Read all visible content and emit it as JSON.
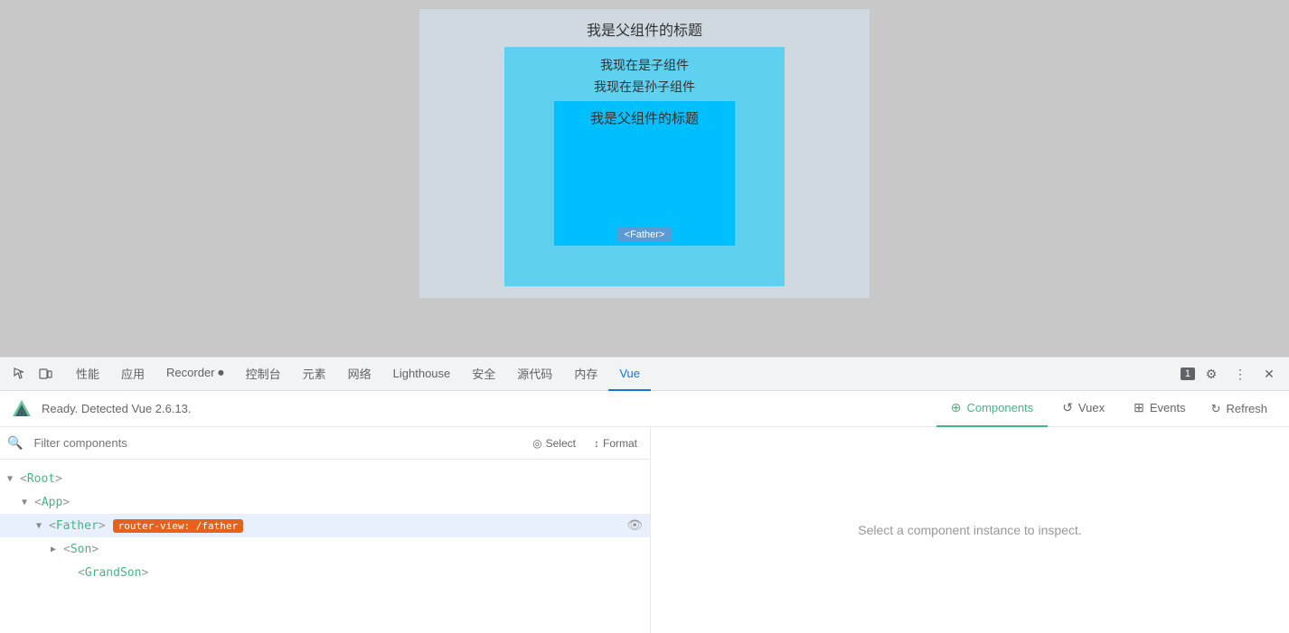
{
  "preview": {
    "outer_title": "我是父组件的标题",
    "child_text": "我现在是子组件",
    "grandchild_text": "我现在是孙子组件",
    "inner_title": "我是父组件的标题",
    "father_badge": "<Father>"
  },
  "devtools": {
    "tabs": [
      {
        "label": "性能",
        "active": false
      },
      {
        "label": "应用",
        "active": false
      },
      {
        "label": "Recorder ⏺",
        "active": false
      },
      {
        "label": "控制台",
        "active": false
      },
      {
        "label": "元素",
        "active": false
      },
      {
        "label": "网络",
        "active": false
      },
      {
        "label": "Lighthouse",
        "active": false
      },
      {
        "label": "安全",
        "active": false
      },
      {
        "label": "源代码",
        "active": false
      },
      {
        "label": "内存",
        "active": false
      },
      {
        "label": "Vue",
        "active": true
      }
    ],
    "badge_count": "1",
    "more_icon": "⋮",
    "close_icon": "✕"
  },
  "vue_panel": {
    "logo_text": "V",
    "status": "Ready. Detected Vue 2.6.13.",
    "tabs": [
      {
        "label": "Components",
        "icon": "⊕",
        "active": true
      },
      {
        "label": "Vuex",
        "icon": "↺",
        "active": false
      },
      {
        "label": "Events",
        "icon": "⊞",
        "active": false
      }
    ],
    "refresh_label": "Refresh",
    "search_placeholder": "Filter components",
    "select_label": "Select",
    "format_label": "Format",
    "tree": [
      {
        "label": "<Root>",
        "depth": 0,
        "arrow": "▼",
        "selected": false,
        "route": ""
      },
      {
        "label": "<App>",
        "depth": 1,
        "arrow": "▼",
        "selected": false,
        "route": ""
      },
      {
        "label": "<Father>",
        "depth": 2,
        "arrow": "▼",
        "selected": true,
        "route": "router-view: /father"
      },
      {
        "label": "<Son>",
        "depth": 3,
        "arrow": "▶",
        "selected": false,
        "route": ""
      },
      {
        "label": "<GrandSon>",
        "depth": 4,
        "arrow": "",
        "selected": false,
        "route": ""
      }
    ],
    "inspector_placeholder": "Select a component instance to inspect."
  }
}
